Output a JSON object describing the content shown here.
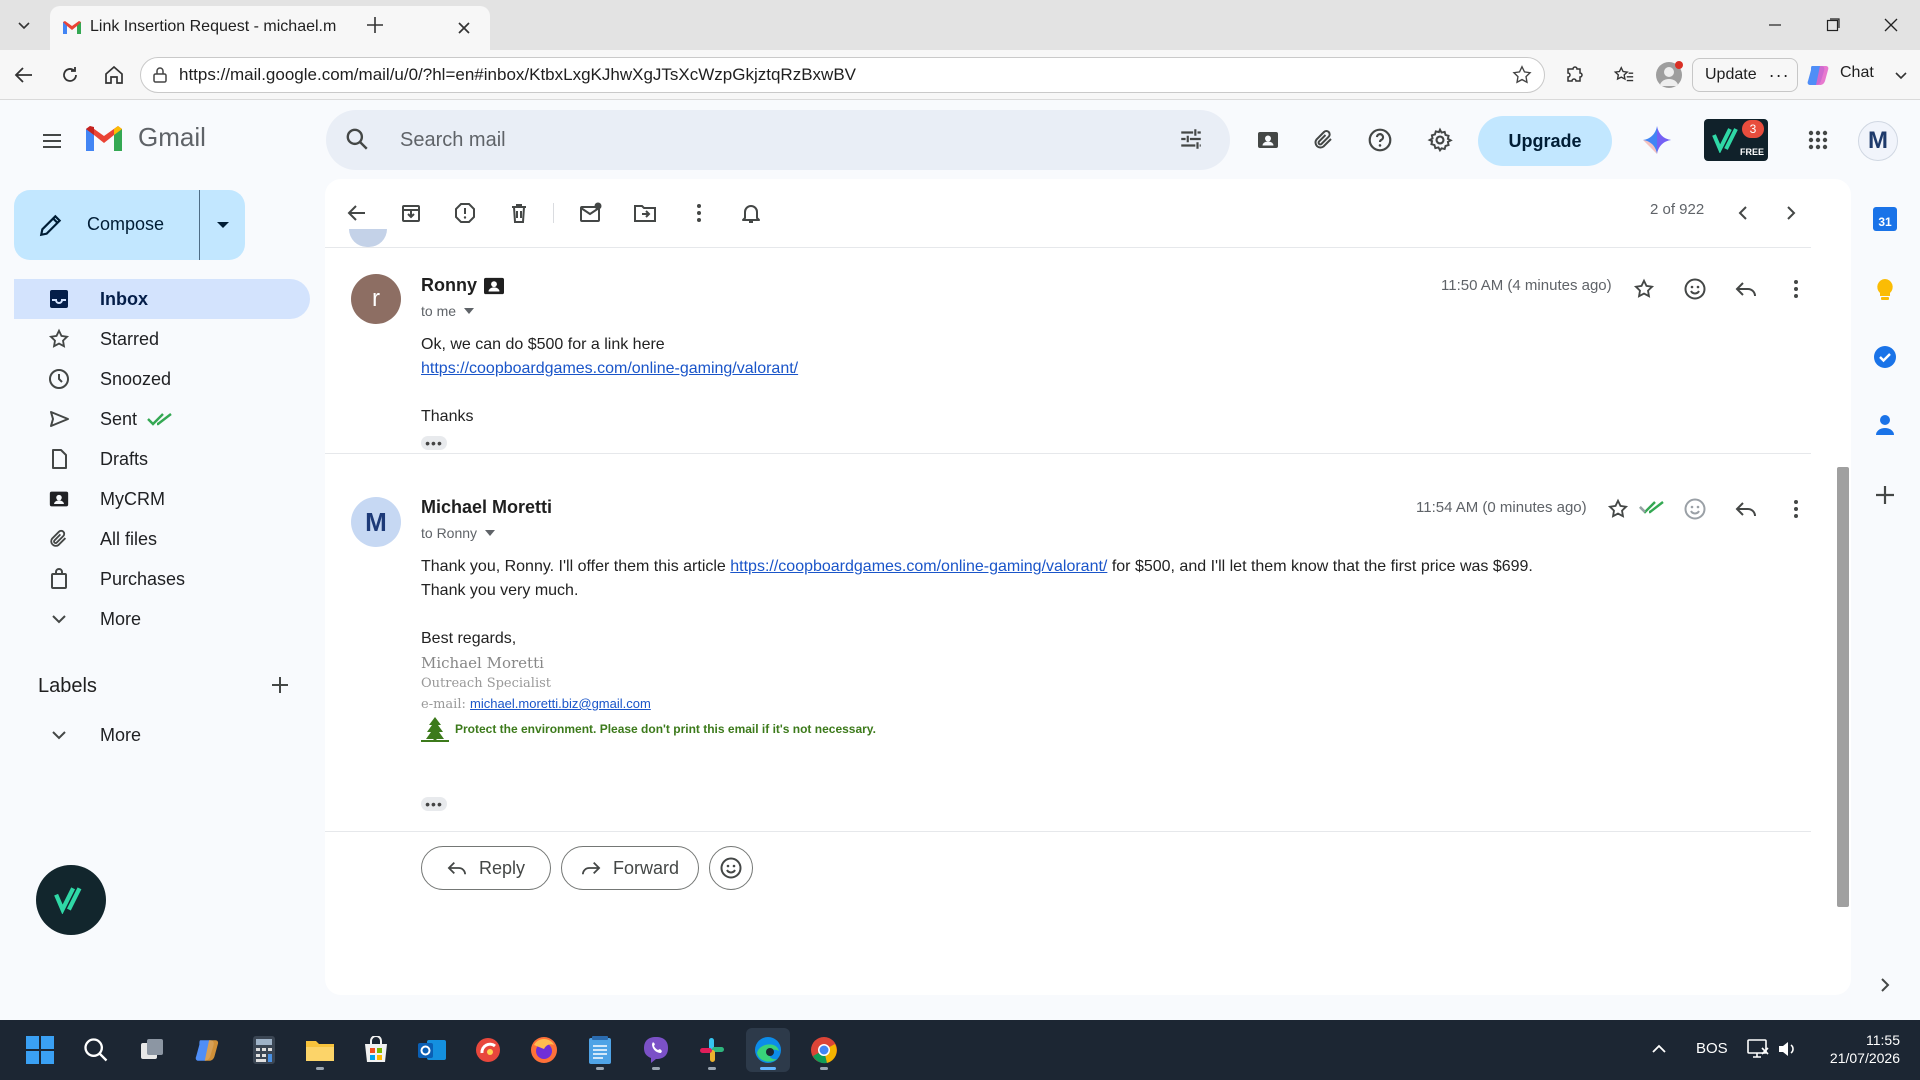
{
  "browser": {
    "tab_title": "Link Insertion Request - michael.m",
    "url": "https://mail.google.com/mail/u/0/?hl=en#inbox/KtbxLxgKJhwXgJTsXcWzpGkjztqRzBxwBV",
    "update_label": "Update",
    "chat_label": "Chat"
  },
  "gmail": {
    "logo_text": "Gmail",
    "search_placeholder": "Search mail",
    "upgrade_label": "Upgrade",
    "ext_badge_count": "3",
    "ext_badge_text": "FREE",
    "account_initial": "M",
    "compose_label": "Compose",
    "nav": [
      {
        "label": "Inbox",
        "icon": "inbox-icon",
        "active": true
      },
      {
        "label": "Starred",
        "icon": "star-icon"
      },
      {
        "label": "Snoozed",
        "icon": "clock-icon"
      },
      {
        "label": "Sent",
        "icon": "send-icon"
      },
      {
        "label": "Drafts",
        "icon": "draft-icon"
      },
      {
        "label": "MyCRM",
        "icon": "contact-card-icon"
      },
      {
        "label": "All files",
        "icon": "paperclip-icon"
      },
      {
        "label": "Purchases",
        "icon": "bag-icon"
      },
      {
        "label": "More",
        "icon": "chevron-down-icon"
      }
    ],
    "labels_heading": "Labels",
    "labels_more": "More",
    "pagination": "2 of 922"
  },
  "thread": {
    "messages": [
      {
        "sender": "Ronny",
        "avatar_letter": "r",
        "recipient": "to me",
        "time": "11:50 AM (4 minutes ago)",
        "line1": "Ok, we can do $500 for a link here",
        "link": "https://coopboardgames.com/online-gaming/valorant/",
        "line3": "Thanks"
      },
      {
        "sender": "Michael Moretti",
        "avatar_letter": "M",
        "recipient": "to Ronny",
        "time": "11:54 AM (0 minutes ago)",
        "line1_pre": "Thank you, Ronny. I'll offer them this article ",
        "line1_link": "https://coopboardgames.com/online-gaming/valorant/",
        "line1_post": " for $500, and I'll let them know that the first price was $699.",
        "line2": "Thank you very much.",
        "regards": "Best regards,",
        "sig_name": "Michael Moretti",
        "sig_title": "Outreach Specialist",
        "sig_email_label": "e-mail:",
        "sig_email": "michael.moretti.biz@gmail.com",
        "sig_env": "Protect the environment. Please don't print this email if it's not necessary."
      }
    ],
    "reply_label": "Reply",
    "forward_label": "Forward"
  },
  "side_panel": {
    "calendar_day": "31"
  },
  "taskbar": {
    "lang": "BOS",
    "time": "11:55",
    "date": "21/07/2026"
  },
  "colors": {
    "accent": "#0b57d0",
    "gmail_red": "#ea4335",
    "active_nav": "#d3e3fd",
    "env_green": "#3c7a1b"
  }
}
